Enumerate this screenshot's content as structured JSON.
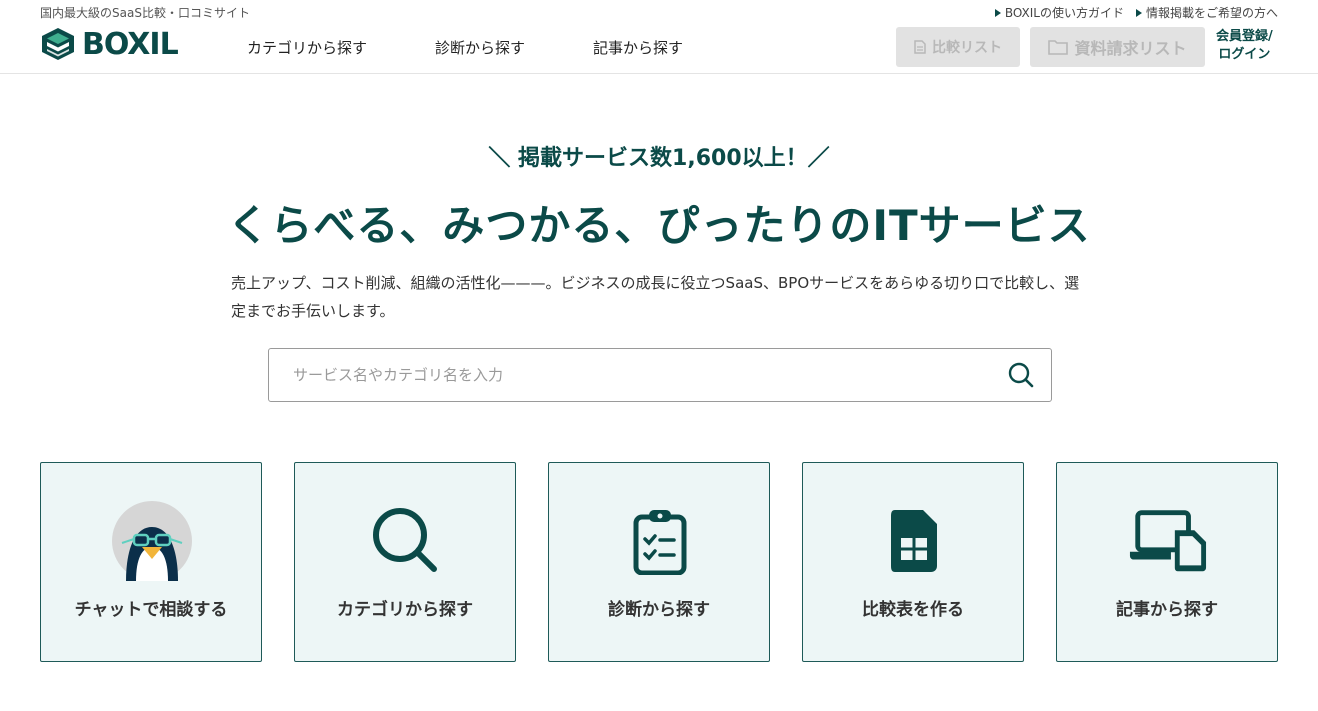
{
  "header": {
    "tagline": "国内最大級のSaaS比較・口コミサイト",
    "util_links": [
      {
        "label": "BOXILの使い方ガイド"
      },
      {
        "label": "情報掲載をご希望の方へ"
      }
    ],
    "logo_text": "BOXIL",
    "nav": [
      {
        "label": "カテゴリから探す"
      },
      {
        "label": "診断から探す"
      },
      {
        "label": "記事から探す"
      }
    ],
    "compare_list_label": "比較リスト",
    "docs_list_label": "資料請求リスト",
    "login_line1": "会員登録/",
    "login_line2": "ログイン"
  },
  "hero": {
    "badge": "＼ 掲載サービス数1,600以上！／",
    "title": "くらべる、みつかる、ぴったりのITサービス",
    "description": "売上アップ、コスト削減、組織の活性化———。ビジネスの成長に役立つSaaS、BPOサービスをあらゆる切り口で比較し、選定までお手伝いします。"
  },
  "search": {
    "placeholder": "サービス名やカテゴリ名を入力",
    "value": "",
    "icon": "search-icon"
  },
  "cards": [
    {
      "label": "チャットで相談する",
      "icon": "penguin-avatar-icon"
    },
    {
      "label": "カテゴリから探す",
      "icon": "search-icon"
    },
    {
      "label": "診断から探す",
      "icon": "clipboard-checklist-icon"
    },
    {
      "label": "比較表を作る",
      "icon": "document-table-icon"
    },
    {
      "label": "記事から探す",
      "icon": "laptop-phone-icon"
    }
  ],
  "colors": {
    "brand": "#0b4a48",
    "card_bg": "#edf6f6",
    "highlight": "#f6ec9c",
    "disabled_button": "#e2e2e2"
  }
}
